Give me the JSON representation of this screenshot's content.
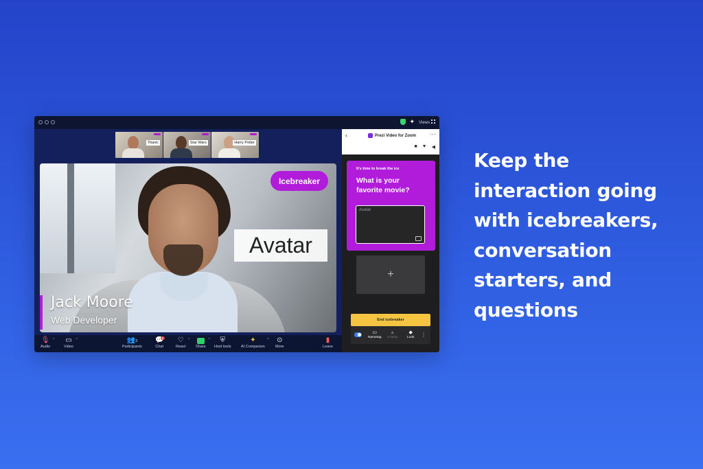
{
  "headline": {
    "lines": [
      "Keep the",
      "interaction going",
      "with icebreakers,",
      "conversation",
      "starters, and",
      "questions"
    ]
  },
  "titlebar": {
    "views_label": "Views"
  },
  "gallery": [
    {
      "tag": "Titanic"
    },
    {
      "tag": "Star Wars"
    },
    {
      "tag": "Harry Potter"
    }
  ],
  "main_video": {
    "pill": "Icebreaker",
    "avatar_label": "Avatar",
    "name": "Jack Moore",
    "role": "Web Developer"
  },
  "toolbar": {
    "audio": "Audio",
    "video": "Video",
    "participants": "Participants",
    "participants_count": "3",
    "chat": "Chat",
    "chat_badge": "1",
    "react": "React",
    "share": "Share",
    "host_tools": "Host tools",
    "ai_companion": "AI Companion",
    "more": "More",
    "leave": "Leave"
  },
  "panel": {
    "title": "Prezi Video for Zoom",
    "card": {
      "kicker": "It's time to break the ice",
      "question": "What is your favorite movie?",
      "placeholder": "Avatar"
    },
    "add_symbol": "+",
    "end_button": "End icebreaker",
    "footer": {
      "nametag": "Nametag",
      "activity": "Activity",
      "look": "Look"
    }
  },
  "colors": {
    "accent": "#b01cd9",
    "end_button": "#f5c542",
    "share_green": "#2fd06a",
    "leave_red": "#ff5a5a"
  },
  "icons": [
    "shield-icon",
    "sparkle-icon",
    "grid-icon",
    "microphone-icon",
    "camera-icon",
    "people-icon",
    "chat-icon",
    "heart-icon",
    "share-icon",
    "shield-host-icon",
    "ai-sparkle-icon",
    "more-icon",
    "leave-icon",
    "back-icon",
    "ellipsis-icon",
    "image-icon",
    "plus-icon"
  ]
}
